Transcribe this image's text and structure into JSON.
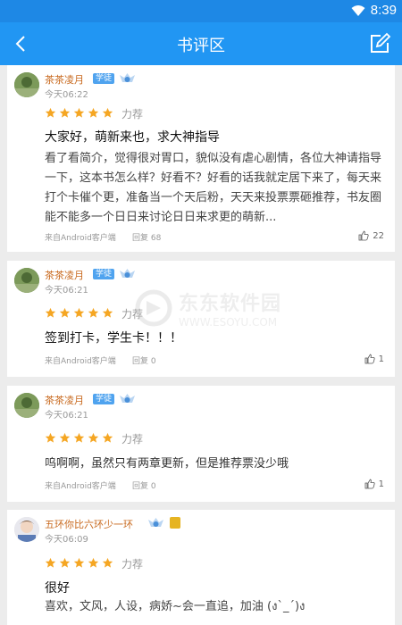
{
  "status_bar": {
    "time": "8:39"
  },
  "header": {
    "title": "书评区"
  },
  "posts": [
    {
      "user": "茶茶凌月",
      "badge": "学徒",
      "time": "今天06:22",
      "rating": 5,
      "recommend": "力荐",
      "title": "大家好，萌新来也，求大神指导",
      "body": "看了看简介，觉得很对胃口，貌似没有虐心剧情，各位大神请指导一下，这本书怎么样？好看不？好看的话我就定居下来了，每天来打个卡催个更，准备当一个天后粉，天天来投票票砸推荐，书友圈能不能多一个日日来讨论日日来求更的萌新...",
      "source": "来自Android客户端",
      "reply": "回复 68",
      "likes": "22"
    },
    {
      "user": "茶茶凌月",
      "badge": "学徒",
      "time": "今天06:21",
      "rating": 5,
      "recommend": "力荐",
      "title": "签到打卡，学生卡！！！",
      "source": "来自Android客户端",
      "reply": "回复 0",
      "likes": "1"
    },
    {
      "user": "茶茶凌月",
      "badge": "学徒",
      "time": "今天06:21",
      "rating": 5,
      "recommend": "力荐",
      "title": "呜啊啊，虽然只有两章更新，但是推荐票没少哦",
      "source": "来自Android客户端",
      "reply": "回复 0",
      "likes": "1"
    },
    {
      "user": "五环你比六环少一环",
      "time": "今天06:09",
      "rating": 5,
      "recommend": "力荐",
      "title": "很好",
      "body": "喜欢，文风，人设，病娇~会一直追，加油 (งˋ_ˊ)ง"
    }
  ],
  "watermark": {
    "text": "东东软件园",
    "url": "WWW.ESOYU.COM"
  },
  "colors": {
    "primary": "#2196f3",
    "status_bar": "#1e88e5",
    "star": "#f5a623",
    "username": "#c8691e",
    "badge": "#4fa3ef"
  }
}
